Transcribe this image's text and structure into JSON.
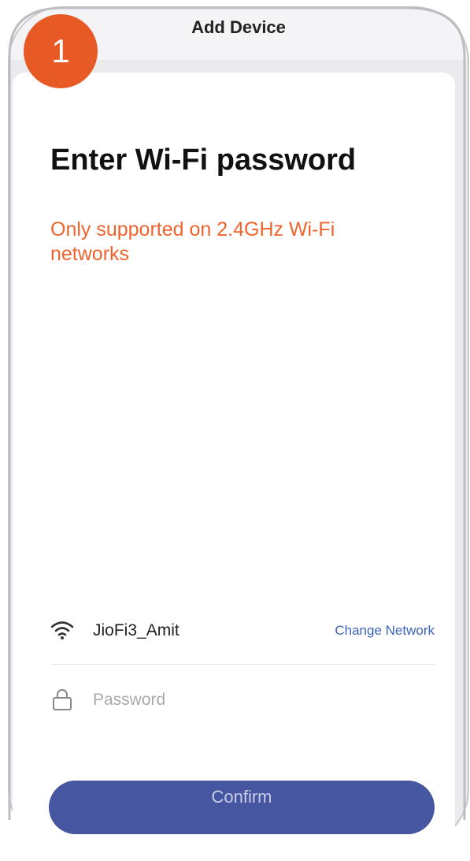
{
  "header": {
    "title": "Add Device",
    "back_icon": "back-arrow-icon"
  },
  "step": {
    "number": "1",
    "color": "#e85a25"
  },
  "main": {
    "heading": "Enter Wi-Fi password",
    "warning": "Only supported on 2.4GHz Wi-Fi networks",
    "warning_color": "#f0632d"
  },
  "network": {
    "icon": "wifi-icon",
    "name": "JioFi3_Amit",
    "change_label": "Change Network",
    "link_color": "#3d64b8"
  },
  "password": {
    "icon": "lock-icon",
    "value": "",
    "placeholder": "Password"
  },
  "confirm": {
    "label": "Confirm",
    "color": "#4656a0"
  }
}
